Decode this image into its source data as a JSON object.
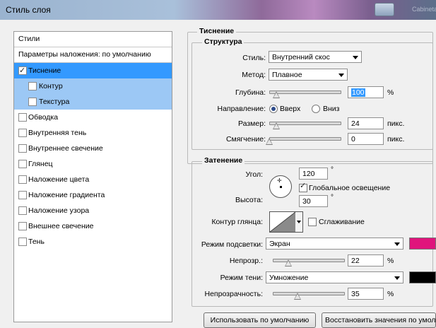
{
  "window": {
    "title": "Стиль слоя",
    "ghost_text": "Cabinetal..."
  },
  "styles_panel": {
    "header": "Стили",
    "blending": "Параметры наложения: по умолчанию",
    "items": [
      {
        "label": "Тиснение",
        "checked": true,
        "selected": true,
        "sub": false
      },
      {
        "label": "Контур",
        "checked": false,
        "selected": false,
        "sub": true
      },
      {
        "label": "Текстура",
        "checked": false,
        "selected": false,
        "sub": true
      },
      {
        "label": "Обводка",
        "checked": false,
        "selected": false,
        "sub": false
      },
      {
        "label": "Внутренняя тень",
        "checked": false,
        "selected": false,
        "sub": false
      },
      {
        "label": "Внутреннее свечение",
        "checked": false,
        "selected": false,
        "sub": false
      },
      {
        "label": "Глянец",
        "checked": false,
        "selected": false,
        "sub": false
      },
      {
        "label": "Наложение цвета",
        "checked": false,
        "selected": false,
        "sub": false
      },
      {
        "label": "Наложение градиента",
        "checked": false,
        "selected": false,
        "sub": false
      },
      {
        "label": "Наложение узора",
        "checked": false,
        "selected": false,
        "sub": false
      },
      {
        "label": "Внешнее свечение",
        "checked": false,
        "selected": false,
        "sub": false
      },
      {
        "label": "Тень",
        "checked": false,
        "selected": false,
        "sub": false
      }
    ]
  },
  "bevel": {
    "section_title": "Тиснение",
    "structure_title": "Структура",
    "style_label": "Стиль:",
    "style_value": "Внутренний скос",
    "method_label": "Метод:",
    "method_value": "Плавное",
    "depth_label": "Глубина:",
    "depth_value": "100",
    "depth_level": 0.1,
    "depth_unit": "%",
    "direction_label": "Направление:",
    "direction_up": "Вверх",
    "direction_down": "Вниз",
    "size_label": "Размер:",
    "size_value": "24",
    "size_level": 0.1,
    "size_unit": "пикс.",
    "soften_label": "Смягчение:",
    "soften_value": "0",
    "soften_level": 0.0,
    "soften_unit": "пикс."
  },
  "shading": {
    "title": "Затенение",
    "angle_label": "Угол:",
    "angle_value": "120",
    "degree": "°",
    "global_light_label": "Глобальное освещение",
    "global_light_checked": true,
    "altitude_label": "Высота:",
    "altitude_value": "30",
    "gloss_label": "Контур глянца:",
    "antialias_label": "Сглаживание",
    "highlight_mode_label": "Режим подсветки:",
    "highlight_mode_value": "Экран",
    "highlight_color": "#e0147c",
    "highlight_opacity_label": "Непрозр.:",
    "highlight_opacity_value": "22",
    "highlight_opacity_level": 0.22,
    "shadow_mode_label": "Режим тени:",
    "shadow_mode_value": "Умножение",
    "shadow_color": "#000000",
    "shadow_opacity_label": "Непрозрачность:",
    "shadow_opacity_value": "35",
    "shadow_opacity_level": 0.35,
    "percent": "%"
  },
  "buttons": {
    "make_default": "Использовать по умолчанию",
    "reset_default": "Восстановить значения по умолчанию"
  }
}
